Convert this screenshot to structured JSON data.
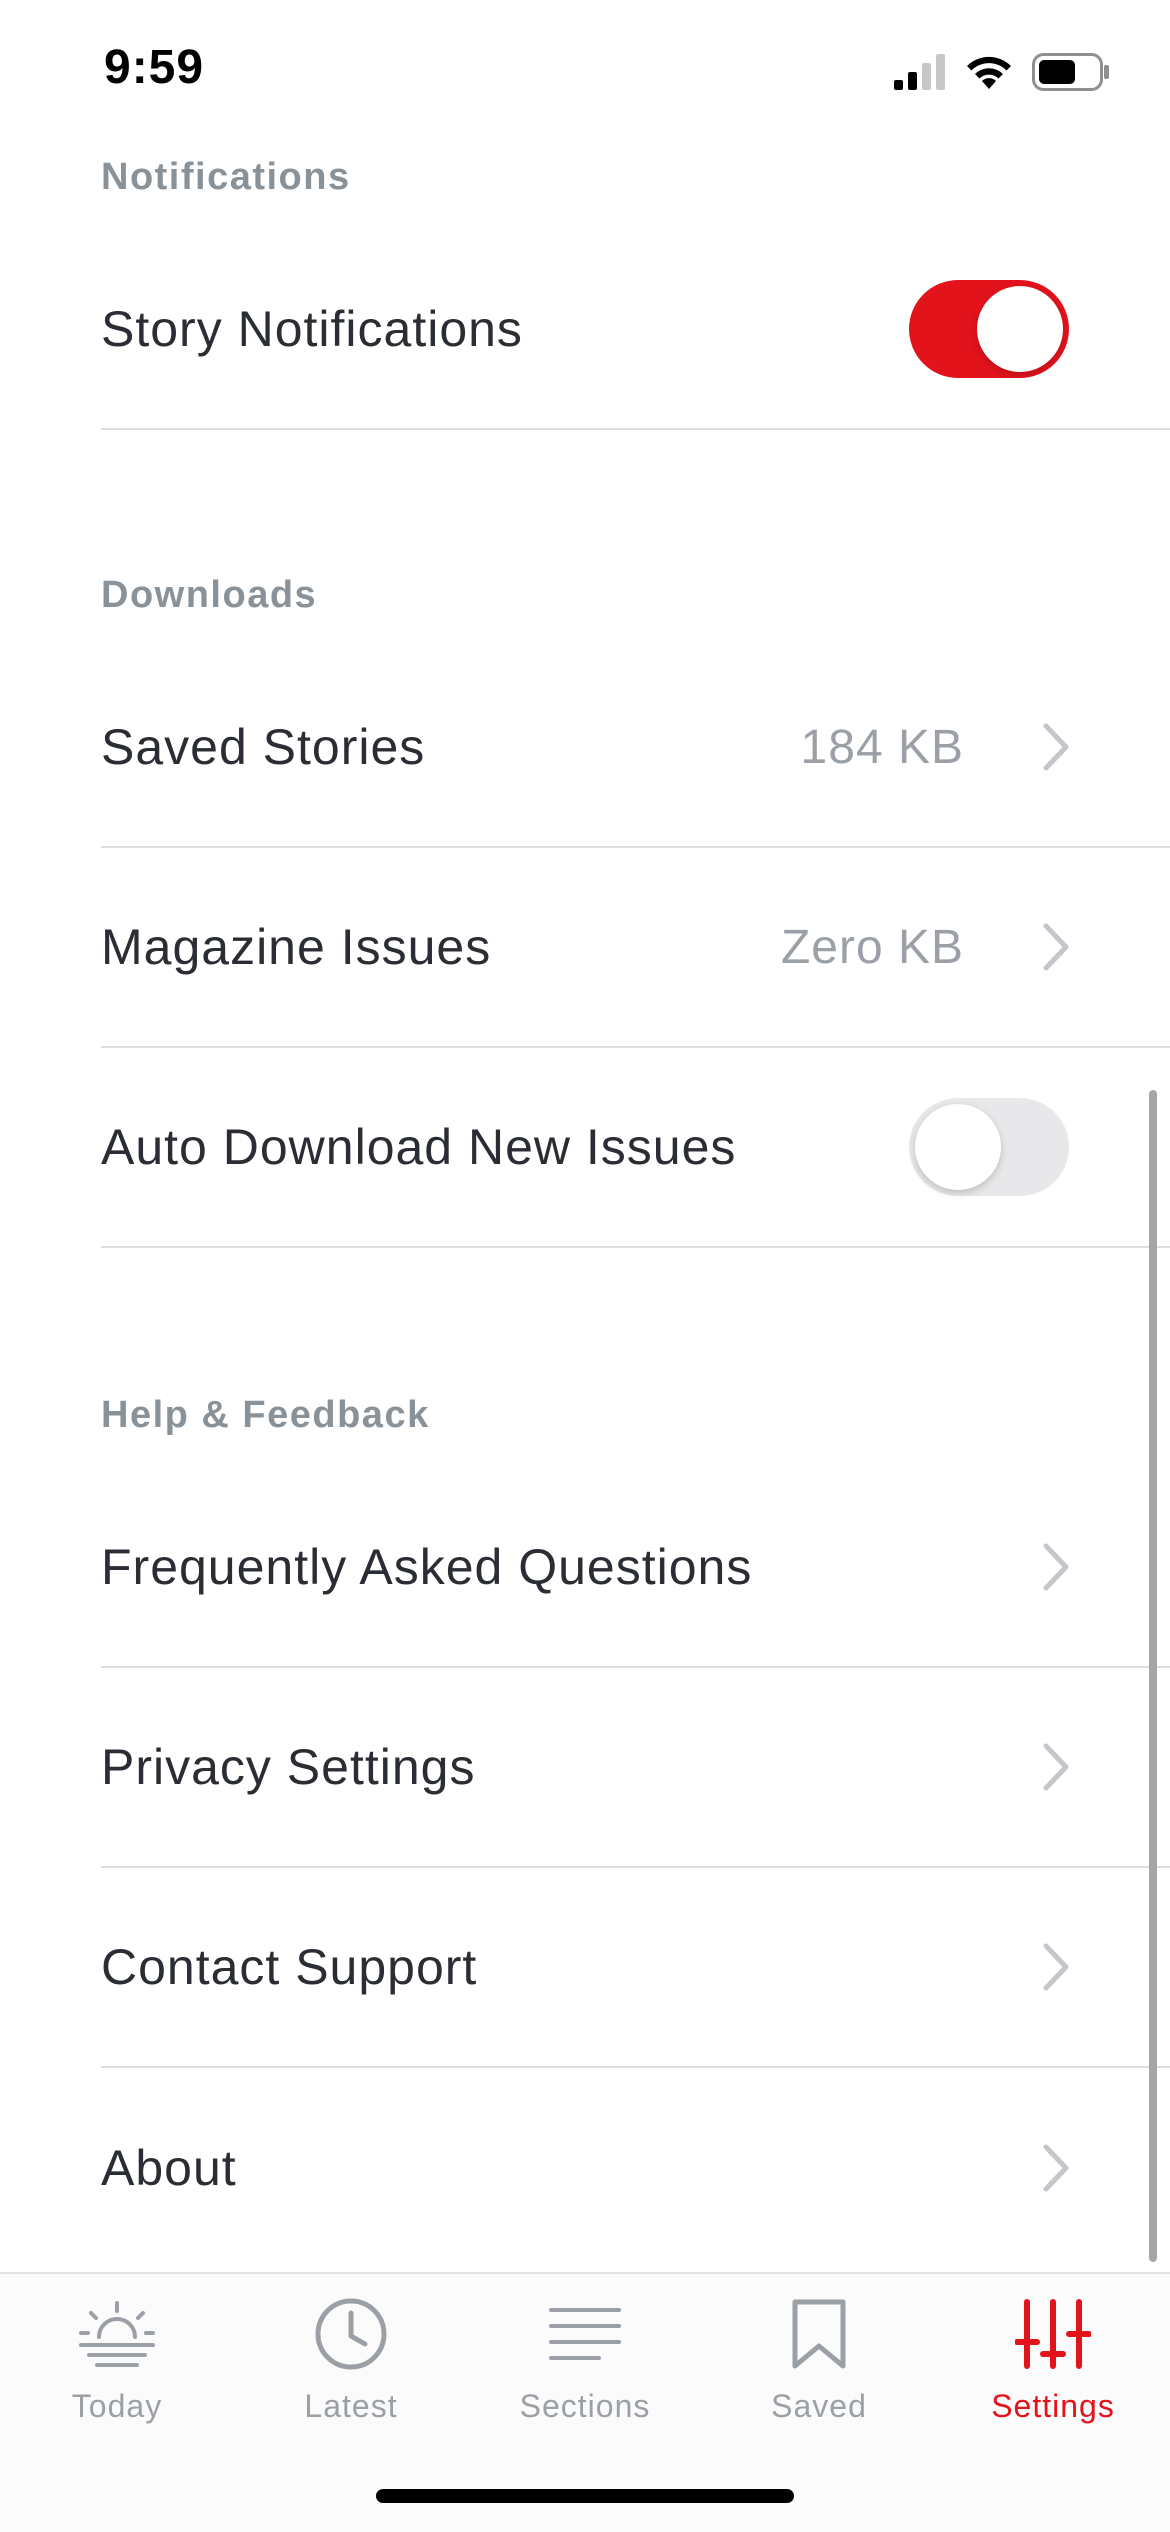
{
  "status_bar": {
    "time": "9:59"
  },
  "sections": {
    "notifications": {
      "header": "Notifications",
      "story_notifications": {
        "label": "Story Notifications",
        "enabled": true
      }
    },
    "downloads": {
      "header": "Downloads",
      "saved_stories": {
        "label": "Saved Stories",
        "value": "184 KB"
      },
      "magazine_issues": {
        "label": "Magazine Issues",
        "value": "Zero KB"
      },
      "auto_download": {
        "label": "Auto Download New Issues",
        "enabled": false
      }
    },
    "help": {
      "header": "Help & Feedback",
      "faq": {
        "label": "Frequently Asked Questions"
      },
      "privacy": {
        "label": "Privacy Settings"
      },
      "contact": {
        "label": "Contact Support"
      },
      "about": {
        "label": "About"
      }
    }
  },
  "tab_bar": {
    "tabs": [
      {
        "label": "Today",
        "icon": "sunrise-icon",
        "active": false
      },
      {
        "label": "Latest",
        "icon": "clock-icon",
        "active": false
      },
      {
        "label": "Sections",
        "icon": "lines-icon",
        "active": false
      },
      {
        "label": "Saved",
        "icon": "bookmark-icon",
        "active": false
      },
      {
        "label": "Settings",
        "icon": "sliders-icon",
        "active": true
      }
    ]
  },
  "colors": {
    "accent": "#e3131c",
    "section_header": "#8a9299",
    "text": "#2a2d33",
    "secondary_text": "#9aa0a6",
    "divider": "#dedfe1"
  }
}
